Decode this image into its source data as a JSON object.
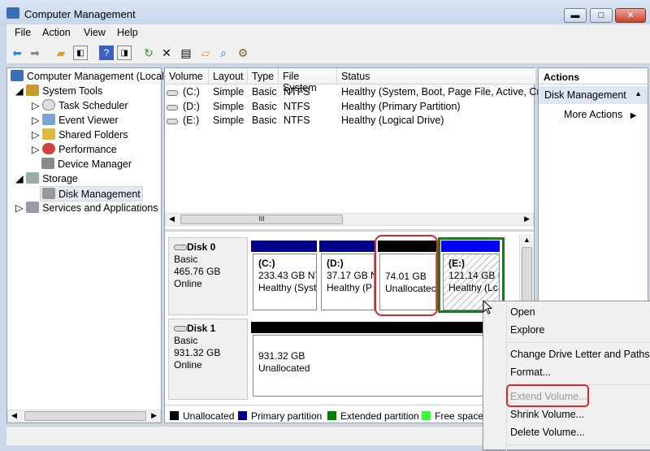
{
  "window": {
    "title": "Computer Management",
    "minimize": "▬",
    "maximize": "□",
    "close": "✕"
  },
  "menu": [
    "File",
    "Action",
    "View",
    "Help"
  ],
  "toolbar_icons": [
    "back-icon",
    "forward-icon",
    "up-folder-icon",
    "show-hide-tree-icon",
    "help-icon",
    "show-hide-action-icon",
    "refresh-icon",
    "delete-icon",
    "properties-icon",
    "open-icon",
    "search-icon",
    "settings-icon"
  ],
  "tree": {
    "root": "Computer Management (Local",
    "system_tools": "System Tools",
    "task_scheduler": "Task Scheduler",
    "event_viewer": "Event Viewer",
    "shared_folders": "Shared Folders",
    "performance": "Performance",
    "device_manager": "Device Manager",
    "storage": "Storage",
    "disk_management": "Disk Management",
    "services": "Services and Applications"
  },
  "volumes": {
    "headers": [
      "Volume",
      "Layout",
      "Type",
      "File System",
      "Status"
    ],
    "rows": [
      [
        "(C:)",
        "Simple",
        "Basic",
        "NTFS",
        "Healthy (System, Boot, Page File, Active, Cras"
      ],
      [
        "(D:)",
        "Simple",
        "Basic",
        "NTFS",
        "Healthy (Primary Partition)"
      ],
      [
        "(E:)",
        "Simple",
        "Basic",
        "NTFS",
        "Healthy (Logical Drive)"
      ]
    ],
    "scroll_grip": "III"
  },
  "disks": [
    {
      "name": "Disk 0",
      "type": "Basic",
      "size": "465.76 GB",
      "state": "Online",
      "partitions": [
        {
          "label": "(C:)",
          "size": "233.43 GB NT",
          "status": "Healthy (Syst"
        },
        {
          "label": "(D:)",
          "size": "37.17 GB N",
          "status": "Healthy (P"
        },
        {
          "label": "",
          "size": "74.01 GB",
          "status": "Unallocatec"
        },
        {
          "label": "(E:)",
          "size": "121.14 GB N",
          "status": "Healthy (Lc"
        }
      ]
    },
    {
      "name": "Disk 1",
      "type": "Basic",
      "size": "931.32 GB",
      "state": "Online",
      "partitions": [
        {
          "size": "931.32 GB",
          "status": "Unallocated"
        }
      ]
    }
  ],
  "legend": [
    {
      "label": "Unallocated",
      "color": "#000000"
    },
    {
      "label": "Primary partition",
      "color": "#00008b"
    },
    {
      "label": "Extended partition",
      "color": "#008000"
    },
    {
      "label": "Free space",
      "color": "#33ff33"
    }
  ],
  "actions": {
    "header": "Actions",
    "section": "Disk Management",
    "more": "More Actions"
  },
  "context_menu": [
    "Open",
    "Explore",
    "Change Drive Letter and Paths...",
    "Format...",
    "Extend Volume...",
    "Shrink Volume...",
    "Delete Volume..."
  ]
}
